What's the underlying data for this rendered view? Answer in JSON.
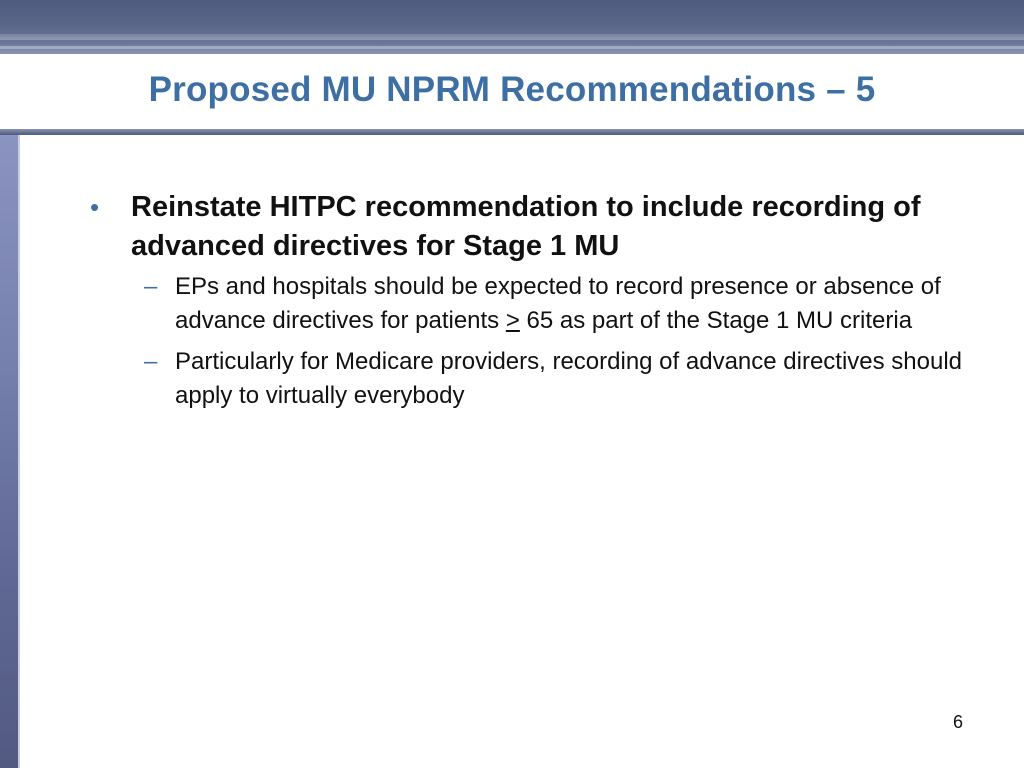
{
  "slide": {
    "title": "Proposed MU NPRM Recommendations – 5",
    "page_number": "6",
    "accent_color": "#3d6fa5",
    "banner_color": "#5a6688"
  },
  "content": {
    "bullet": {
      "icon": "bullet-dot",
      "text": "Reinstate HITPC recommendation to include recording of advanced directives for Stage 1 MU"
    },
    "sub_items": [
      {
        "icon": "dash",
        "text_before": "EPs and hospitals should be expected to record presence or absence of advance directives for patients ",
        "symbol": ">",
        "text_after": " 65 as part of the Stage 1 MU criteria"
      },
      {
        "icon": "dash",
        "text": "Particularly for Medicare providers, recording of advance directives should apply to virtually everybody"
      }
    ]
  }
}
